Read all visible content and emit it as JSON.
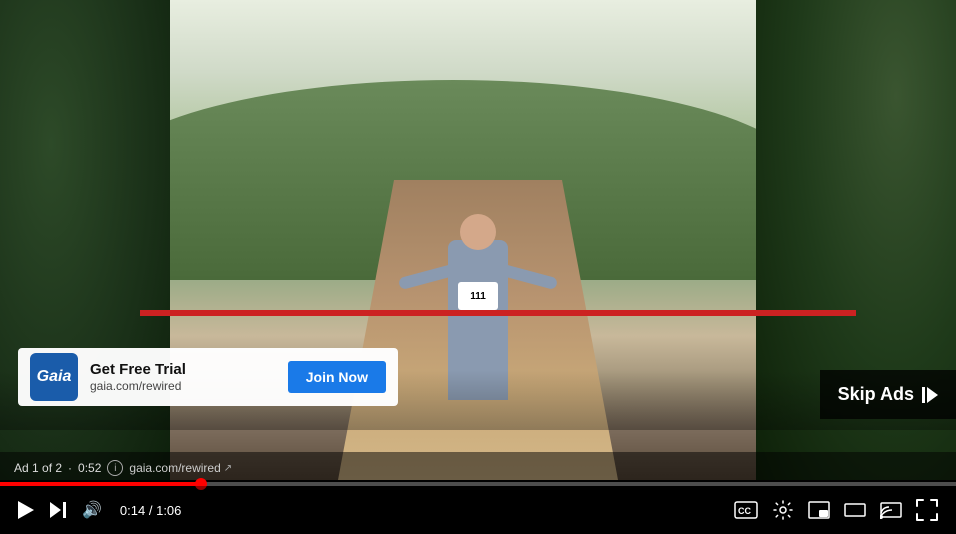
{
  "video": {
    "duration": "1:06",
    "current_time": "0:14",
    "progress_percent": 21
  },
  "ad": {
    "label": "Ad 1 of 2",
    "time_remaining": "0:52",
    "website": "gaia.com/rewired",
    "logo_text": "Gaia",
    "title": "Get Free Trial",
    "url_display": "gaia.com/rewired",
    "join_label": "Join Now"
  },
  "controls": {
    "play_label": "Play",
    "next_label": "Next",
    "volume_label": "Volume",
    "cc_label": "Closed Captions",
    "settings_label": "Settings",
    "miniplayer_label": "Miniplayer",
    "theater_label": "Theater mode",
    "cast_label": "Cast",
    "fullscreen_label": "Fullscreen"
  },
  "skip": {
    "label": "Skip Ads"
  },
  "runner": {
    "bib_number": "111"
  }
}
